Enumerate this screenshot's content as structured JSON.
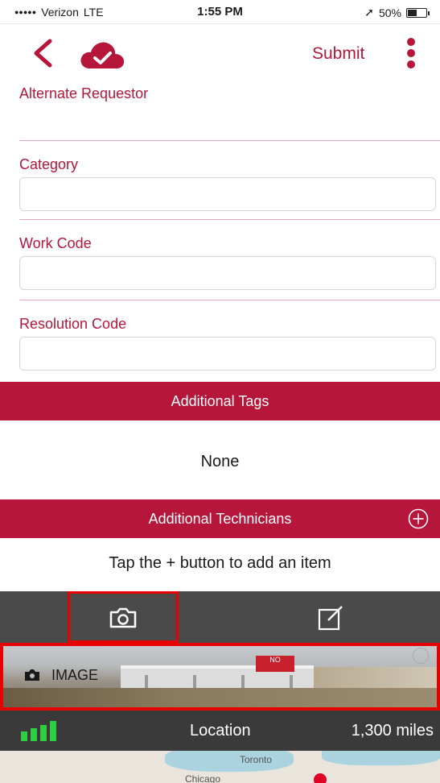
{
  "status_bar": {
    "signal_dots": "●●●●●",
    "carrier": "Verizon",
    "network": "LTE",
    "time": "1:55 PM",
    "location_arrow": "➚",
    "battery": "50%",
    "battery_level": 0.5
  },
  "nav": {
    "back_icon": "chevron-left",
    "cloud_icon": "cloud-check",
    "submit_label": "Submit",
    "menu_icon": "kebab-vertical"
  },
  "form": {
    "alternate_requestor_label": "Alternate Requestor",
    "category_label": "Category",
    "category_value": "",
    "work_code_label": "Work Code",
    "work_code_value": "",
    "resolution_code_label": "Resolution Code",
    "resolution_code_value": ""
  },
  "additional_tags": {
    "header": "Additional Tags",
    "value": "None"
  },
  "additional_technicians": {
    "header": "Additional Technicians",
    "empty_text": "Tap the + button to add an item"
  },
  "toolbar": {
    "camera_icon": "camera",
    "edit_icon": "edit-square"
  },
  "image": {
    "label": "IMAGE",
    "sign_text": "NO"
  },
  "location": {
    "label": "Location",
    "distance": "1,300 miles"
  },
  "map": {
    "city_1": "Toronto",
    "city_2": "Chicago"
  },
  "colors": {
    "brand": "#b5163a",
    "highlight": "#e60000",
    "signal_green": "#2ecc40"
  }
}
